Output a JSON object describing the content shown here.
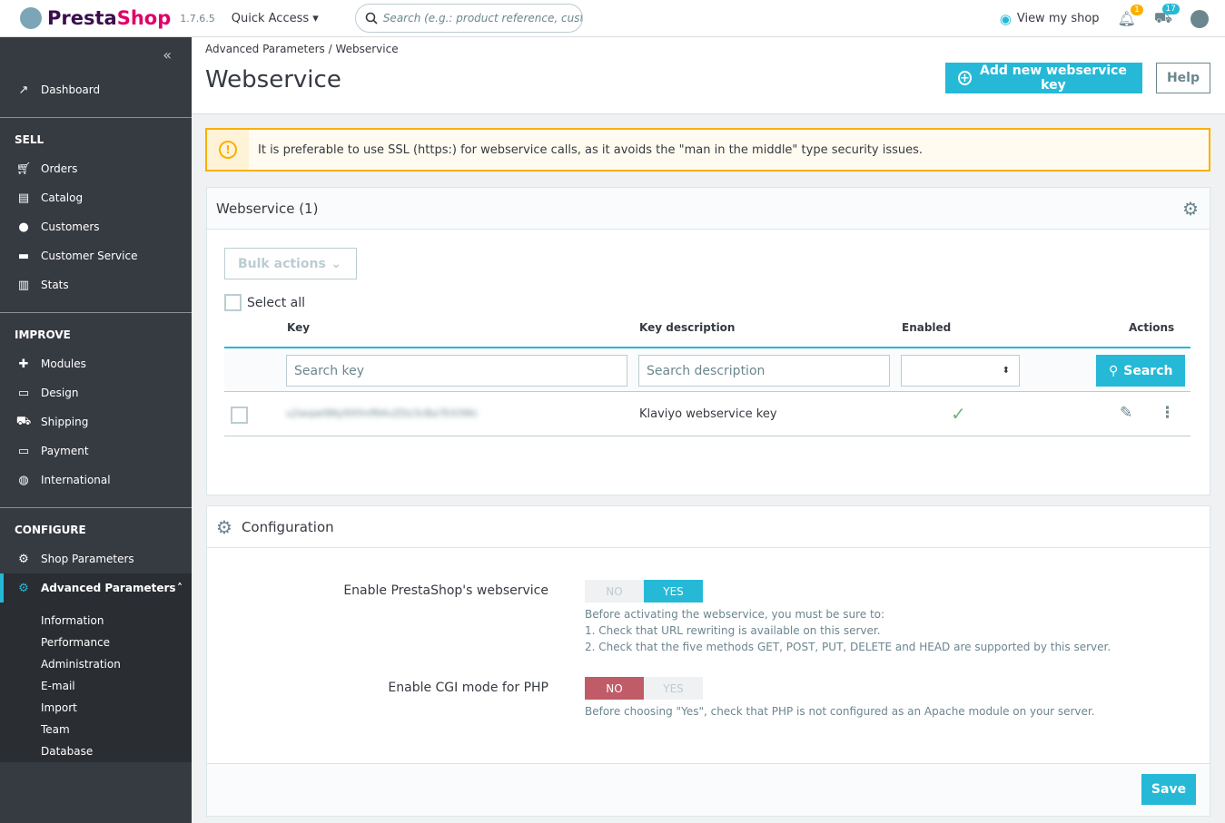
{
  "topbar": {
    "brand_a": "Presta",
    "brand_b": "Shop",
    "version": "1.7.6.5",
    "quick_access": "Quick Access",
    "search_placeholder": "Search (e.g.: product reference, custome",
    "view_shop": "View my shop",
    "notif_count": "1",
    "orders_count": "17"
  },
  "sidebar": {
    "dashboard": "Dashboard",
    "sections": [
      {
        "title": "SELL",
        "items": [
          "Orders",
          "Catalog",
          "Customers",
          "Customer Service",
          "Stats"
        ]
      },
      {
        "title": "IMPROVE",
        "items": [
          "Modules",
          "Design",
          "Shipping",
          "Payment",
          "International"
        ]
      },
      {
        "title": "CONFIGURE",
        "items": [
          "Shop Parameters",
          "Advanced Parameters"
        ]
      }
    ],
    "submenu": [
      "Information",
      "Performance",
      "Administration",
      "E-mail",
      "Import",
      "Team",
      "Database"
    ]
  },
  "header": {
    "breadcrumb": [
      "Advanced Parameters",
      "Webservice"
    ],
    "title": "Webservice",
    "add_button": "Add new webservice key",
    "help_button": "Help"
  },
  "alert": {
    "text": "It is preferable to use SSL (https:) for webservice calls, as it avoids the \"man in the middle\" type security issues."
  },
  "list": {
    "title": "Webservice (1)",
    "bulk_actions": "Bulk actions",
    "select_all": "Select all",
    "columns": [
      "Key",
      "Key description",
      "Enabled",
      "Actions"
    ],
    "filters": {
      "key_placeholder": "Search key",
      "desc_placeholder": "Search description",
      "search_button": "Search"
    },
    "rows": [
      {
        "key": "u2wqwt8Ky9XfmfN4vZDz3cBa7E43Wc",
        "description": "Klaviyo webservice key",
        "enabled": true
      }
    ]
  },
  "config": {
    "title": "Configuration",
    "ws_label": "Enable PrestaShop's webservice",
    "ws_no": "NO",
    "ws_yes": "YES",
    "ws_value": "YES",
    "ws_help": [
      "Before activating the webservice, you must be sure to:",
      "1. Check that URL rewriting is available on this server.",
      "2. Check that the five methods GET, POST, PUT, DELETE and HEAD are supported by this server."
    ],
    "cgi_label": "Enable CGI mode for PHP",
    "cgi_no": "NO",
    "cgi_yes": "YES",
    "cgi_value": "NO",
    "cgi_help": "Before choosing \"Yes\", check that PHP is not configured as an Apache module on your server.",
    "save": "Save"
  },
  "colors": {
    "accent": "#25b9d7",
    "sidebar": "#363a41",
    "warning": "#fab000",
    "danger": "#c05c67",
    "success": "#70b580"
  }
}
